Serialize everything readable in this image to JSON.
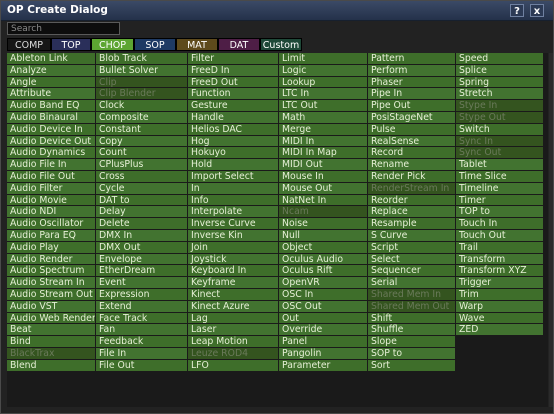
{
  "window": {
    "title": "OP Create Dialog",
    "help_label": "?",
    "close_label": "x"
  },
  "search": {
    "placeholder": "Search"
  },
  "tabs": [
    {
      "label": "COMP",
      "bg": "#161616",
      "fg": "#dddddd",
      "w": 44
    },
    {
      "label": "TOP",
      "bg": "#2a2f5a",
      "fg": "#ffffff",
      "w": 40
    },
    {
      "label": "CHOP",
      "bg": "#5da532",
      "fg": "#ffffff",
      "w": 43
    },
    {
      "label": "SOP",
      "bg": "#1e3a64",
      "fg": "#ffffff",
      "w": 42
    },
    {
      "label": "MAT",
      "bg": "#5e4a1c",
      "fg": "#ffffff",
      "w": 42
    },
    {
      "label": "DAT",
      "bg": "#4e1e46",
      "fg": "#ffffff",
      "w": 42
    },
    {
      "label": "Custom",
      "bg": "#1e4838",
      "fg": "#ffffff",
      "w": 42
    }
  ],
  "columns": [
    [
      "Ableton Link",
      "Analyze",
      "Angle",
      "Attribute",
      "Audio Band EQ",
      "Audio Binaural",
      "Audio Device In",
      "Audio Device Out",
      "Audio Dynamics",
      "Audio File In",
      "Audio File Out",
      "Audio Filter",
      "Audio Movie",
      "Audio NDI",
      "Audio Oscillator",
      "Audio Para EQ",
      "Audio Play",
      "Audio Render",
      "Audio Spectrum",
      "Audio Stream In",
      "Audio Stream Out",
      "Audio VST",
      "Audio Web Render",
      "Beat",
      "Bind",
      "BlackTrax",
      "Blend"
    ],
    [
      "Blob Track",
      "Bullet Solver",
      "Clip",
      "Clip Blender",
      "Clock",
      "Composite",
      "Constant",
      "Copy",
      "Count",
      "CPlusPlus",
      "Cross",
      "Cycle",
      "DAT to",
      "Delay",
      "Delete",
      "DMX In",
      "DMX Out",
      "Envelope",
      "EtherDream",
      "Event",
      "Expression",
      "Extend",
      "Face Track",
      "Fan",
      "Feedback",
      "File In",
      "File Out"
    ],
    [
      "Filter",
      "FreeD In",
      "FreeD Out",
      "Function",
      "Gesture",
      "Handle",
      "Helios DAC",
      "Hog",
      "Hokuyo",
      "Hold",
      "Import Select",
      "In",
      "Info",
      "Interpolate",
      "Inverse Curve",
      "Inverse Kin",
      "Join",
      "Joystick",
      "Keyboard In",
      "Keyframe",
      "Kinect",
      "Kinect Azure",
      "Lag",
      "Laser",
      "Leap Motion",
      "Leuze ROD4",
      "LFO"
    ],
    [
      "Limit",
      "Logic",
      "Lookup",
      "LTC In",
      "LTC Out",
      "Math",
      "Merge",
      "MIDI In",
      "MIDI In Map",
      "MIDI Out",
      "Mouse In",
      "Mouse Out",
      "NatNet In",
      "Ncam",
      "Noise",
      "Null",
      "Object",
      "Oculus Audio",
      "Oculus Rift",
      "OpenVR",
      "OSC In",
      "OSC Out",
      "Out",
      "Override",
      "Panel",
      "Pangolin",
      "Parameter"
    ],
    [
      "Pattern",
      "Perform",
      "Phaser",
      "Pipe In",
      "Pipe Out",
      "PosiStageNet",
      "Pulse",
      "RealSense",
      "Record",
      "Rename",
      "Render Pick",
      "RenderStream In",
      "Reorder",
      "Replace",
      "Resample",
      "S Curve",
      "Script",
      "Select",
      "Sequencer",
      "Serial",
      "Shared Mem In",
      "Shared Mem Out",
      "Shift",
      "Shuffle",
      "Slope",
      "SOP to",
      "Sort"
    ],
    [
      "Speed",
      "Splice",
      "Spring",
      "Stretch",
      "Stype In",
      "Stype Out",
      "Switch",
      "Sync In",
      "Sync Out",
      "Tablet",
      "Time Slice",
      "Timeline",
      "Timer",
      "TOP to",
      "Touch In",
      "Touch Out",
      "Trail",
      "Transform",
      "Transform XYZ",
      "Trigger",
      "Trim",
      "Warp",
      "Wave",
      "ZED",
      "",
      "",
      ""
    ]
  ],
  "disabled": [
    "Clip",
    "Clip Blender",
    "BlackTrax",
    "Leuze ROD4",
    "Ncam",
    "RenderStream In",
    "Shared Mem In",
    "Shared Mem Out",
    "Stype In",
    "Stype Out",
    "Sync In",
    "Sync Out"
  ]
}
